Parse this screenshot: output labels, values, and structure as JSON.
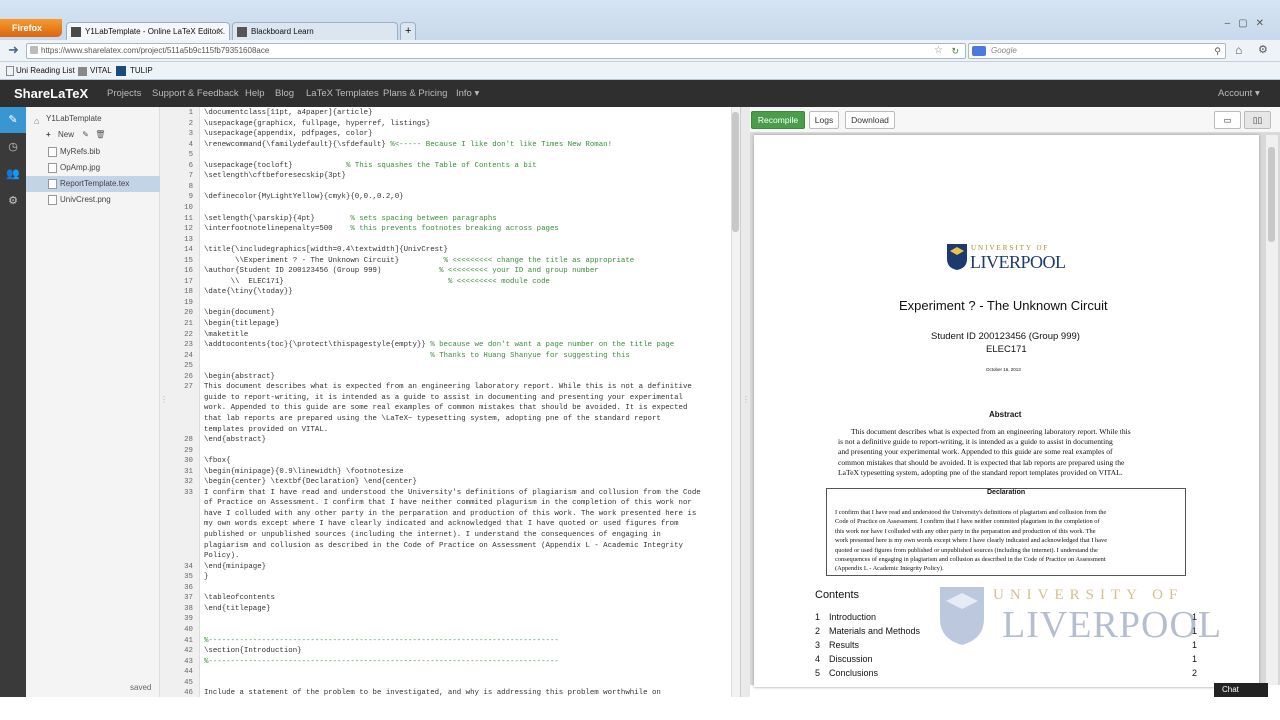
{
  "browser": {
    "menu_button": "Firefox",
    "tabs": [
      {
        "label": "Y1LabTemplate - Online LaTeX Editor..."
      },
      {
        "label": "Blackboard Learn"
      }
    ],
    "new_tab": "+",
    "url": "https://www.sharelatex.com/project/511a5b9c115fb79351608ace",
    "search_placeholder": "Google",
    "bookmarks": [
      "Uni Reading List",
      "VITAL",
      "TULIP"
    ]
  },
  "app": {
    "brand": "ShareLaTeX",
    "nav": [
      "Projects",
      "Support & Feedback",
      "Help",
      "Blog",
      "LaTeX Templates",
      "Plans & Pricing",
      "Info"
    ],
    "account": "Account"
  },
  "file_tree": {
    "project": "Y1LabTemplate",
    "new_label": "New",
    "files": [
      "MyRefs.bib",
      "OpAmp.jpg",
      "ReportTemplate.tex",
      "UnivCrest.png"
    ],
    "selected": "ReportTemplate.tex",
    "status": "saved"
  },
  "editor": {
    "lines": [
      {
        "n": "1",
        "t": "\\documentclass[11pt, a4paper]{article}"
      },
      {
        "n": "2",
        "t": "\\usepackage{graphicx, fullpage, hyperref, listings}"
      },
      {
        "n": "3",
        "t": "\\usepackage{appendix, pdfpages, color}"
      },
      {
        "n": "4",
        "t": "\\renewcommand{\\familydefault}{\\sfdefault} %<----- Because I like don't like Times New Roman!"
      },
      {
        "n": "5",
        "t": ""
      },
      {
        "n": "6",
        "t": "\\usepackage{tocloft}            % This squashes the Table of Contents a bit"
      },
      {
        "n": "7",
        "t": "\\setlength\\cftbeforesecskip{3pt}"
      },
      {
        "n": "8",
        "t": ""
      },
      {
        "n": "9",
        "t": "\\definecolor{MyLightYellow}{cmyk}{0,0.,0.2,0}"
      },
      {
        "n": "10",
        "t": ""
      },
      {
        "n": "11",
        "t": "\\setlength{\\parskip}{4pt}        % sets spacing between paragraphs"
      },
      {
        "n": "12",
        "t": "\\interfootnotelinepenalty=500    % this prevents footnotes breaking across pages"
      },
      {
        "n": "13",
        "t": ""
      },
      {
        "n": "14",
        "t": "\\title{\\includegraphics[width=0.4\\textwidth]{UnivCrest}"
      },
      {
        "n": "15",
        "t": "       \\\\Experiment ? - The Unknown Circuit}          % <<<<<<<<< change the title as appropriate"
      },
      {
        "n": "16",
        "t": "\\author{Student ID 200123456 (Group 999)             % <<<<<<<<< your ID and group number"
      },
      {
        "n": "17",
        "t": "      \\\\  ELEC171}                                     % <<<<<<<<< module code"
      },
      {
        "n": "18",
        "t": "\\date{\\tiny{\\today}}"
      },
      {
        "n": "19",
        "t": ""
      },
      {
        "n": "20",
        "t": "\\begin{document}"
      },
      {
        "n": "21",
        "t": "\\begin{titlepage}"
      },
      {
        "n": "22",
        "t": "\\maketitle"
      },
      {
        "n": "23",
        "t": "\\addtocontents{toc}{\\protect\\thispagestyle{empty}} % because we don't want a page number on the title page"
      },
      {
        "n": "24",
        "t": "                                                   % Thanks to Huang Shanyue for suggesting this"
      },
      {
        "n": "25",
        "t": ""
      },
      {
        "n": "26",
        "t": "\\begin{abstract}"
      },
      {
        "n": "27",
        "t": "This document describes what is expected from an engineering laboratory report. While this is not a definitive"
      },
      {
        "n": "",
        "t": "guide to report-writing, it is intended as a guide to assist in documenting and presenting your experimental"
      },
      {
        "n": "",
        "t": "work. Appended to this guide are some real examples of common mistakes that should be avoided. It is expected"
      },
      {
        "n": "",
        "t": "that lab reports are prepared using the \\LaTeX~ typesetting system, adopting pne of the standard report"
      },
      {
        "n": "",
        "t": "templates provided on VITAL."
      },
      {
        "n": "28",
        "t": "\\end{abstract}"
      },
      {
        "n": "29",
        "t": ""
      },
      {
        "n": "30",
        "t": "\\fbox{"
      },
      {
        "n": "31",
        "t": "\\begin{minipage}{0.9\\linewidth} \\footnotesize"
      },
      {
        "n": "32",
        "t": "\\begin{center} \\textbf{Declaration} \\end{center}"
      },
      {
        "n": "33",
        "t": "I confirm that I have read and understood the University's definitions of plagiarism and collusion from the Code"
      },
      {
        "n": "",
        "t": "of Practice on Assessment. I confirm that I have neither commited plagurism in the completion of this work nor"
      },
      {
        "n": "",
        "t": "have I colluded with any other party in the perparation and production of this work. The work presented here is"
      },
      {
        "n": "",
        "t": "my own words except where I have clearly indicated and acknowledged that I have quoted or used figures from"
      },
      {
        "n": "",
        "t": "published or unpublished sources (including the internet). I understand the consequences of engaging in"
      },
      {
        "n": "",
        "t": "plagiarism and collusion as described in the Code of Practice on Assessment (Appendix L - Academic Integrity"
      },
      {
        "n": "",
        "t": "Policy)."
      },
      {
        "n": "34",
        "t": "\\end{minipage}"
      },
      {
        "n": "35",
        "t": "}"
      },
      {
        "n": "36",
        "t": ""
      },
      {
        "n": "37",
        "t": "\\tableofcontents"
      },
      {
        "n": "38",
        "t": "\\end{titlepage}"
      },
      {
        "n": "39",
        "t": ""
      },
      {
        "n": "40",
        "t": ""
      },
      {
        "n": "41",
        "t": "%-------------------------------------------------------------------------------"
      },
      {
        "n": "42",
        "t": "\\section{Introduction}"
      },
      {
        "n": "43",
        "t": "%-------------------------------------------------------------------------------"
      },
      {
        "n": "44",
        "t": ""
      },
      {
        "n": "45",
        "t": ""
      },
      {
        "n": "46",
        "t": "Include a statement of the problem to be investigated, and why is addressing this problem worthwhile on"
      }
    ]
  },
  "pdf": {
    "buttons": {
      "recompile": "Recompile",
      "logs": "Logs",
      "download": "Download"
    },
    "crest_small": "UNIVERSITY OF",
    "crest_big": "LIVERPOOL",
    "title": "Experiment ? - The Unknown Circuit",
    "author": "Student ID 200123456 (Group 999)",
    "module": "ELEC171",
    "date": "October 16, 2013",
    "abstract_heading": "Abstract",
    "abstract_lines": [
      "This document describes what is expected from an engineering laboratory report.  While this",
      "is not a definitive guide to report-writing, it is intended as a guide to assist in documenting",
      "and presenting your experimental work.  Appended to this guide are some real examples of",
      "common mistakes that should be avoided.  It is expected that lab reports are prepared using the",
      "LaTeX  typesetting system, adopting pne of the standard report templates provided on VITAL."
    ],
    "declaration_heading": "Declaration",
    "declaration_lines": [
      "I confirm that I have read and understood the University's definitions of plagiarism and collusion from the",
      "Code of Practice on Assessment. I confirm that I have neither commited plagurism in the completion of",
      "this work nor have I colluded with any other party in the perparation and production of this work.  The",
      "work presented here is my own words except where I have clearly indicated and acknowledged that I have",
      "quoted or used figures from published or unpublished sources (including the internet).  I understand the",
      "consequences of engaging in plagiarism and collusion as described in the Code of Practice on Assessment",
      "(Appendix L - Academic Integrity Policy)."
    ],
    "contents_heading": "Contents",
    "toc": [
      {
        "num": "1",
        "title": "Introduction",
        "page": "1"
      },
      {
        "num": "2",
        "title": "Materials and Methods",
        "page": "1"
      },
      {
        "num": "3",
        "title": "Results",
        "page": "1"
      },
      {
        "num": "4",
        "title": "Discussion",
        "page": "1"
      },
      {
        "num": "5",
        "title": "Conclusions",
        "page": "2"
      }
    ],
    "watermark_small": "UNIVERSITY OF",
    "watermark_big": "LIVERPOOL"
  },
  "chat": "Chat",
  "colors": {
    "accent": "#3a96d3",
    "recompile": "#4a9e4a",
    "header": "#2f2f2f"
  }
}
